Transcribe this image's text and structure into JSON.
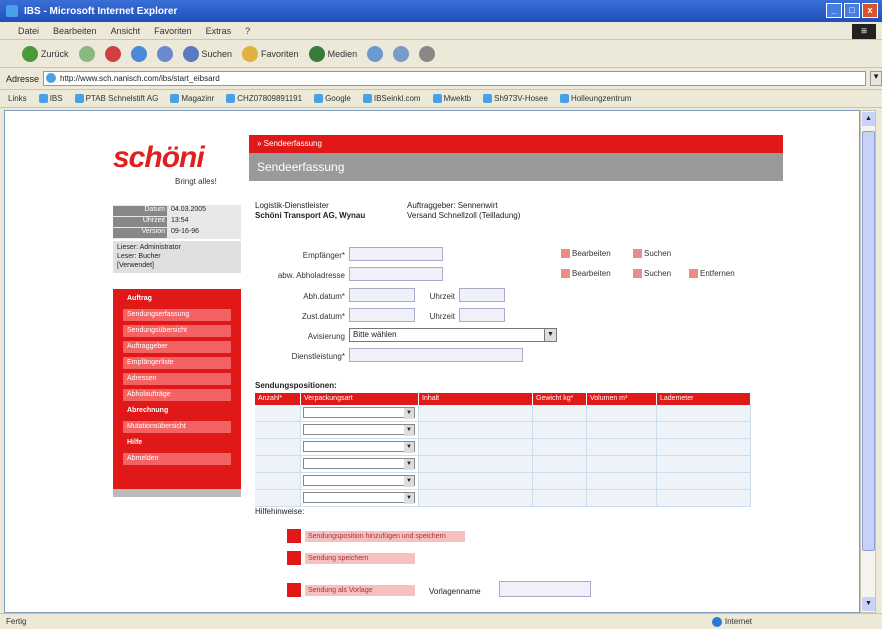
{
  "window": {
    "title": "IBS - Microsoft Internet Explorer"
  },
  "menubar": {
    "items": [
      "Datei",
      "Bearbeiten",
      "Ansicht",
      "Favoriten",
      "Extras",
      "?"
    ]
  },
  "toolbar": {
    "back": "Zurück",
    "search": "Suchen",
    "favorites": "Favoriten",
    "media": "Medien"
  },
  "address": {
    "label": "Adresse",
    "url": "http://www.sch.nanisch.com/ibs/start_eibsard"
  },
  "links": {
    "label": "Links",
    "items": [
      "IBS",
      "PTAB Schnelstift AG",
      "Magazinr",
      "CHZ07809891191",
      "Google",
      "IBSeinkl.com",
      "Mwektb",
      "Sh973V-Hosee",
      "Holleungzentrum"
    ]
  },
  "page": {
    "logo": "schöni",
    "logo_sub": "Bringt alles!",
    "info": [
      {
        "k": "Datum",
        "v": "04.03.2005"
      },
      {
        "k": "Uhrzeit",
        "v": "13:54"
      },
      {
        "k": "Version",
        "v": "09-16-96"
      }
    ],
    "user_info": "Lieser: Administrator\nLeser: Bucher\n[Verwendet]",
    "sidemenu": [
      "Auftrag",
      "Sendungserfassung",
      "Sendungsübersicht",
      "Auftraggeber",
      "Empfängerliste",
      "Adressen",
      "Abholaufträge",
      "Abrechnung",
      "Mutationsübersicht",
      "Hilfe",
      "Abmelden"
    ],
    "header_red": "» Sendeerfassung",
    "header_gray": "Sendeerfassung",
    "meta_left_label": "Logistik-Dienstleister",
    "meta_left_value": "Schöni Transport AG, Wynau",
    "meta_right_label": "Auftraggeber: Sennenwirt",
    "meta_right_value": "Versand   Schnellzoll (Teilladung)",
    "fields": {
      "empfaenger": "Empfänger*",
      "abholadresse": "abw. Abholadresse",
      "abh_datum": "Abh.datum*",
      "zust_datum": "Zust.datum*",
      "zeit1": "Uhrzeit",
      "zeit2": "Uhrzeit",
      "avisierung": "Avisierung",
      "avisierung_value": "Bitte wählen",
      "dienstleistung": "Dienstleistung*"
    },
    "actions_row1": [
      "Bearbeiten",
      "Suchen"
    ],
    "actions_row2": [
      "Bearbeiten",
      "Suchen",
      "Entfernen"
    ],
    "positions_title": "Sendungspositionen:",
    "table_headers": [
      "Anzahl*",
      "Verpackungsart",
      "Inhalt",
      "Gewicht kg*",
      "Volumen m³",
      "Lademeter"
    ],
    "table_rows": 6,
    "hinweis": "Hilfehinweise:",
    "buttons": [
      "Sendungsposition hinzufügen und speichern",
      "Sendung speichern",
      "Sendung als Vorlage"
    ],
    "bottom_label": "Vorlagenname"
  },
  "status": {
    "left": "Fertig",
    "zone": "Internet"
  }
}
